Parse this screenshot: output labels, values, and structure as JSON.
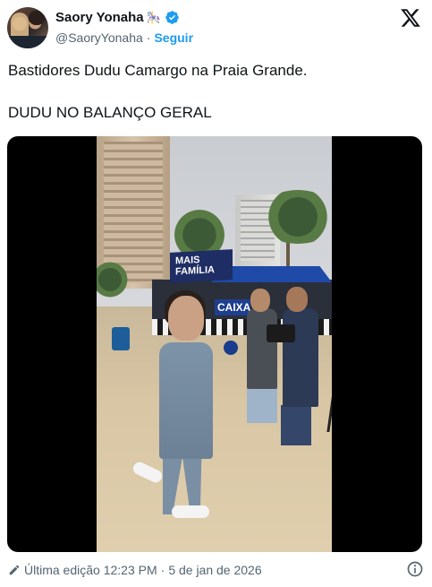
{
  "author": {
    "display_name": "Saory Yonaha",
    "name_emoji": "🎠",
    "handle": "@SaoryYonaha",
    "separator": "·",
    "follow_label": "Seguir",
    "verified": true
  },
  "tweet": {
    "line1": "Bastidores Dudu Camargo na Praia Grande.",
    "line2": "DUDU NO BALANÇO GERAL"
  },
  "media": {
    "type": "video",
    "banner_text": "MAIS FAMÍLIA",
    "sign_text": "CAIXA"
  },
  "footer": {
    "edited_label": "Última edição 12:23 PM",
    "separator": "·",
    "date": "5 de jan de 2026"
  },
  "colors": {
    "accent": "#1d9bf0",
    "text_primary": "#0f1419",
    "text_secondary": "#536471"
  },
  "icons": [
    "verified-icon",
    "x-logo-icon",
    "pencil-icon",
    "info-icon"
  ]
}
